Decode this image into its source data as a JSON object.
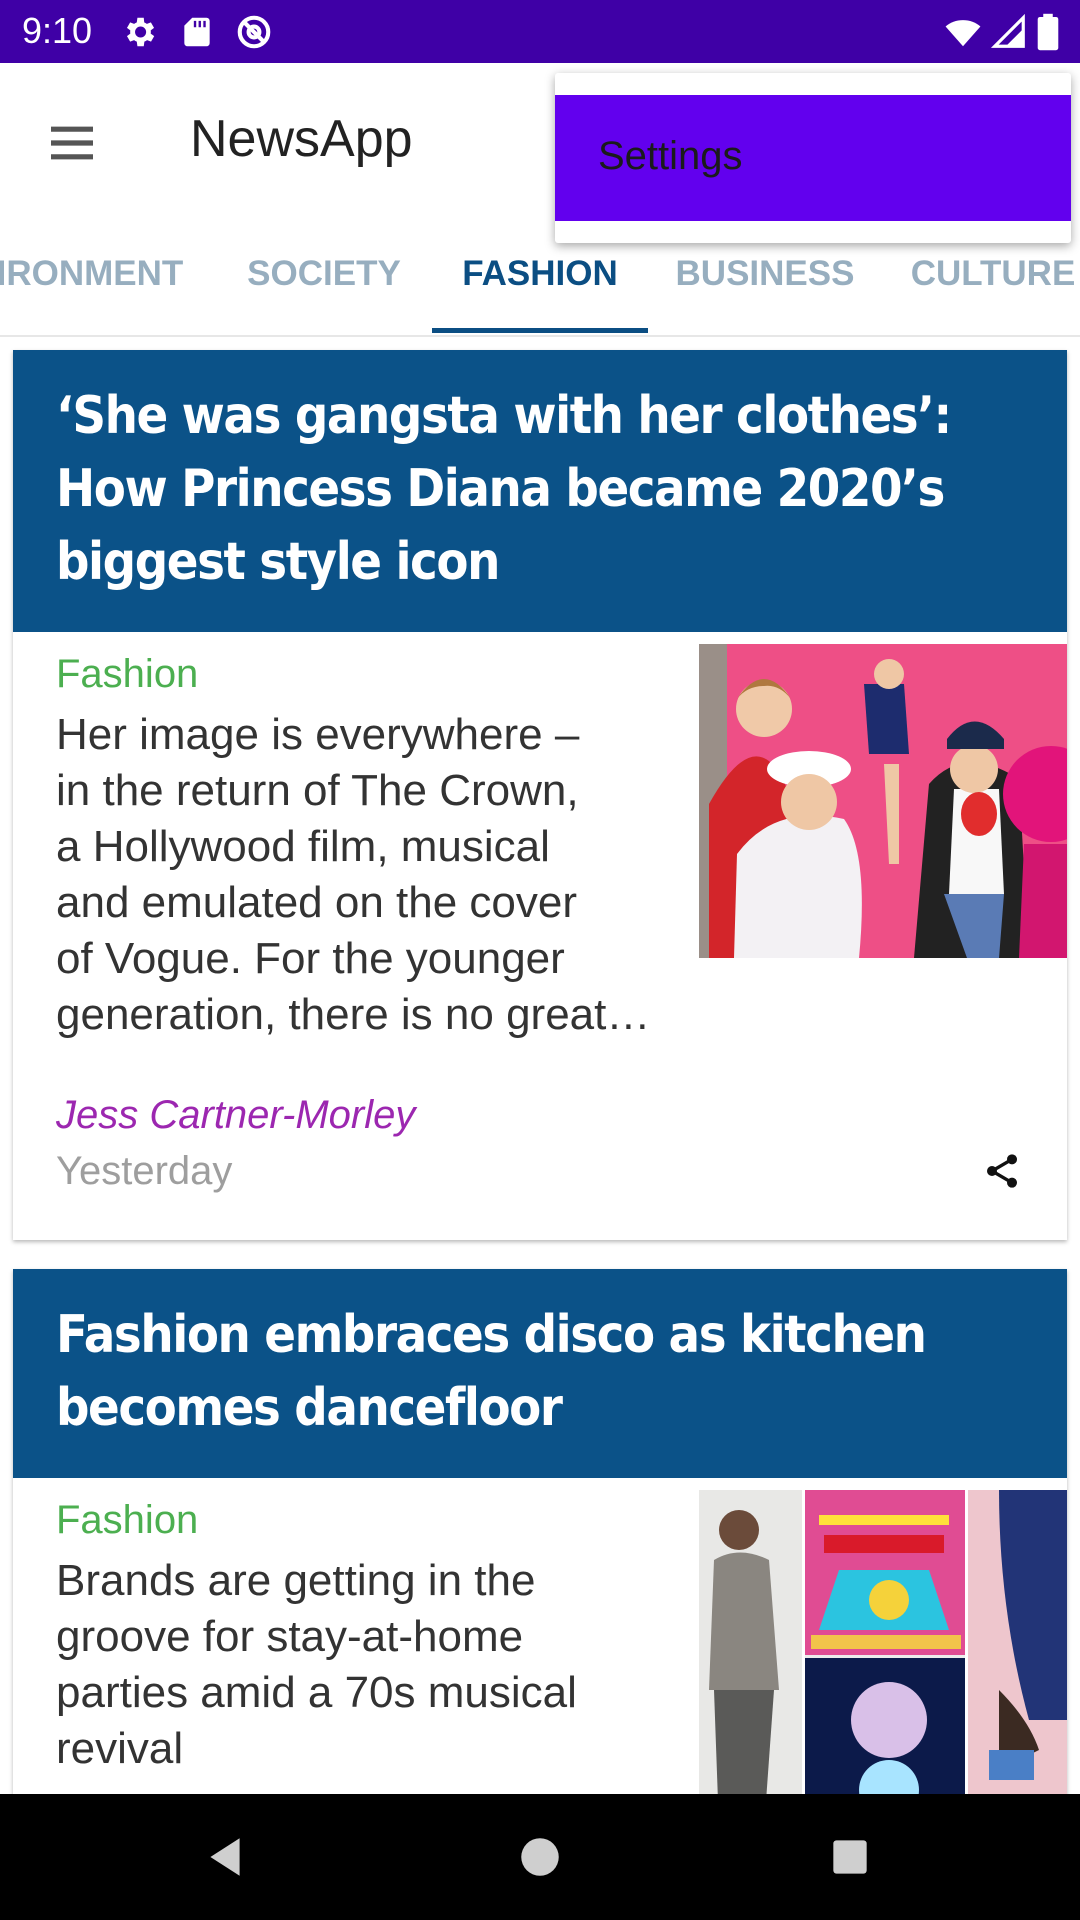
{
  "status_bar": {
    "time": "9:10",
    "bg_color": "#3f00a6",
    "left_icons": [
      "settings-icon",
      "sd-card-icon",
      "at-sign-icon"
    ],
    "right_icons": [
      "wifi-icon",
      "signal-icon",
      "battery-icon"
    ]
  },
  "app_bar": {
    "title": "NewsApp",
    "menu_icon": "hamburger-menu-icon"
  },
  "tabs": {
    "items": [
      {
        "label": "ENVIRONMENT"
      },
      {
        "label": "SOCIETY"
      },
      {
        "label": "FASHION"
      },
      {
        "label": "BUSINESS"
      },
      {
        "label": "CULTURE"
      }
    ],
    "selected": "FASHION",
    "active_color": "#0b4e83",
    "inactive_color": "#97aebf"
  },
  "popup_menu": {
    "items": [
      {
        "label": "Settings"
      }
    ],
    "highlight_color": "#6200ee"
  },
  "articles": [
    {
      "title_lines": [
        "‘She was gangsta with her clothes’:",
        "How Princess Diana became 2020’s",
        "biggest style icon"
      ],
      "section": "Fashion",
      "trail_lines": [
        "Her image is everywhere –",
        "in the return of The Crown,",
        "a Hollywood film, musical",
        "and emulated on the cover",
        "of Vogue. For the younger",
        "generation, there is no great…"
      ],
      "byline": "Jess Cartner-Morley",
      "date": "Yesterday",
      "share_icon": "share-icon",
      "thumbnail": "article-thumbnail-image"
    },
    {
      "title_lines": [
        "Fashion embraces disco as kitchen",
        "becomes dancefloor"
      ],
      "section": "Fashion",
      "trail_lines": [
        "Brands are getting in the",
        "groove for stay-at-home",
        "parties amid a 70s musical",
        "revival"
      ],
      "thumbnail": "article-thumbnail-image"
    }
  ],
  "colors": {
    "card_header": "#0b5288",
    "section_label": "#4caf50",
    "byline": "#9c27b0"
  },
  "nav_bar": {
    "buttons": [
      "back-icon",
      "home-icon",
      "recents-icon"
    ]
  }
}
